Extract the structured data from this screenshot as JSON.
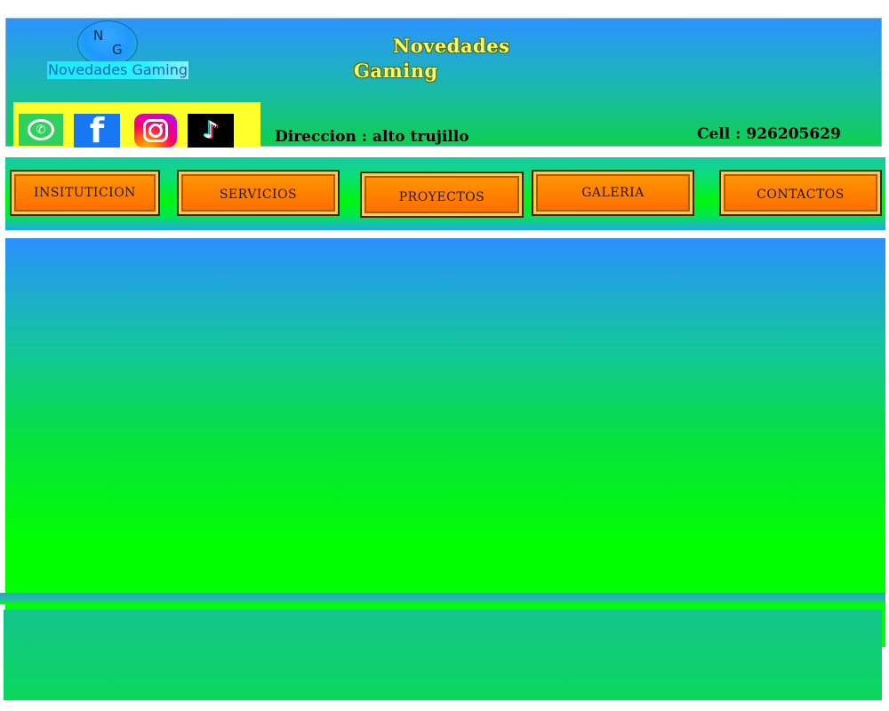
{
  "logo": {
    "letter_n": "N",
    "letter_g": "G",
    "text": "Novedades Gaming"
  },
  "header": {
    "title_line1": "Novedades",
    "title_line2": "Gaming",
    "address": "Direccion : alto trujillo",
    "phone": "Cell : 926205629"
  },
  "social": {
    "items": [
      {
        "name": "whatsapp-icon",
        "color": "#2fd15c"
      },
      {
        "name": "facebook-icon",
        "glyph": "f",
        "color": "#1877f2"
      },
      {
        "name": "instagram-icon",
        "color": "#e1306c"
      },
      {
        "name": "tiktok-icon",
        "glyph": "♪",
        "color": "#000000"
      }
    ]
  },
  "nav": {
    "items": [
      {
        "label": "INSITUTICION"
      },
      {
        "label": "SERVICIOS"
      },
      {
        "label": "PROYECTOS"
      },
      {
        "label": "GALERIA"
      },
      {
        "label": "CONTACTOS"
      }
    ]
  },
  "colors": {
    "header_gradient_top": "#2b93ff",
    "header_gradient_bottom": "#0dd04f",
    "social_panel": "#ffff2a",
    "nav_button": "#ff7a00",
    "main_bottom": "#00ff00"
  }
}
